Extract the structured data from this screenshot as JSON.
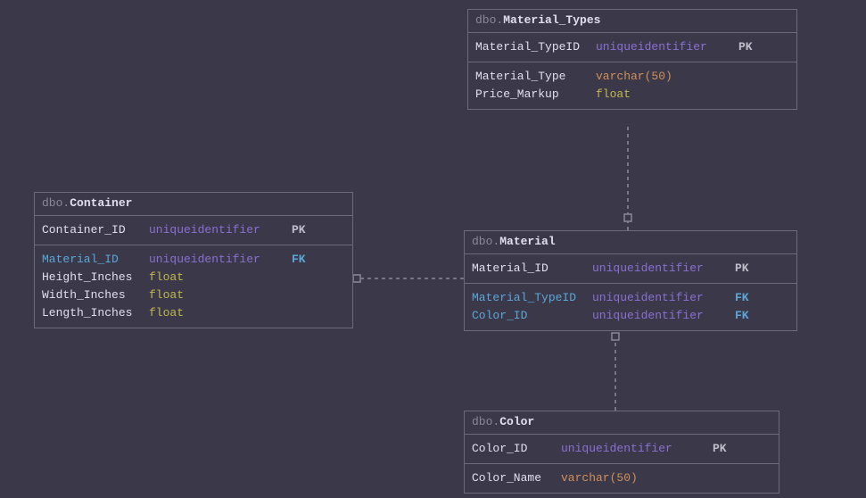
{
  "schema_prefix": "dbo.",
  "tables": {
    "material_types": {
      "name": "Material_Types",
      "pk": {
        "col": "Material_TypeID",
        "type": "uniqueidentifier",
        "key": "PK"
      },
      "cols": [
        {
          "col": "Material_Type",
          "type": "varchar(50)"
        },
        {
          "col": "Price_Markup",
          "type": "float"
        }
      ]
    },
    "container": {
      "name": "Container",
      "pk": {
        "col": "Container_ID",
        "type": "uniqueidentifier",
        "key": "PK"
      },
      "cols": [
        {
          "col": "Material_ID",
          "type": "uniqueidentifier",
          "key": "FK"
        },
        {
          "col": "Height_Inches",
          "type": "float"
        },
        {
          "col": "Width_Inches",
          "type": "float"
        },
        {
          "col": "Length_Inches",
          "type": "float"
        }
      ]
    },
    "material": {
      "name": "Material",
      "pk": {
        "col": "Material_ID",
        "type": "uniqueidentifier",
        "key": "PK"
      },
      "cols": [
        {
          "col": "Material_TypeID",
          "type": "uniqueidentifier",
          "key": "FK"
        },
        {
          "col": "Color_ID",
          "type": "uniqueidentifier",
          "key": "FK"
        }
      ]
    },
    "color": {
      "name": "Color",
      "pk": {
        "col": "Color_ID",
        "type": "uniqueidentifier",
        "key": "PK"
      },
      "cols": [
        {
          "col": "Color_Name",
          "type": "varchar(50)"
        }
      ]
    }
  }
}
